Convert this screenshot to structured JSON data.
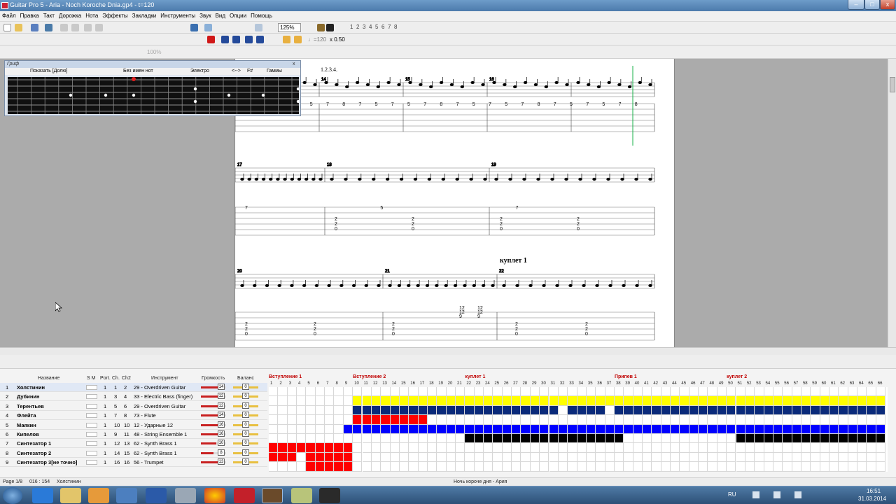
{
  "window": {
    "title": "Guitar Pro 5 - Aria - Noch Koroche Dnia.gp4 - t=120",
    "btn_min": "‒",
    "btn_max": "□",
    "btn_close": "x"
  },
  "menu": [
    "Файл",
    "Правка",
    "Такт",
    "Дорожка",
    "Нота",
    "Эффекты",
    "Закладки",
    "Инструменты",
    "Звук",
    "Вид",
    "Опции",
    "Помощь"
  ],
  "toolbar1": {
    "zoom": "125%",
    "page_numbers": [
      "1",
      "2",
      "3",
      "4",
      "5",
      "6",
      "7",
      "8"
    ]
  },
  "toolbar2": {
    "tempo_label": "♩=120",
    "speed": "x 0.50"
  },
  "toolbar3": {
    "velocity": "100%"
  },
  "fretboard_panel": {
    "title": "Гриф",
    "view": "Показать [Долю]",
    "scale_name": "Без имен нот",
    "tuning": "Электро",
    "key": "F#",
    "scales": "Гаммы",
    "nav": "<-->",
    "close": "x"
  },
  "score": {
    "repeat_ending": "1.2.3.4.",
    "section_label": "куплет 1",
    "systems": [
      {
        "bars": [
          "17",
          "14",
          "15",
          "16"
        ],
        "tab_line1": [
          "8",
          "7",
          "5",
          "7",
          "5",
          "7",
          "8",
          "7",
          "5",
          "7",
          "5",
          "7",
          "8",
          "7",
          "5",
          "7",
          "5",
          "7",
          "8",
          "7",
          "5",
          "7",
          "5",
          "7",
          "8"
        ]
      },
      {
        "bars": [
          "17",
          "18",
          "19"
        ],
        "tab_line1": [
          "7",
          "5",
          "7"
        ],
        "tab_chord": [
          "2",
          "2",
          "0"
        ]
      },
      {
        "bars": [
          "20",
          "21",
          "22"
        ],
        "tab_chord": [
          "2",
          "2",
          "0"
        ],
        "tab_high": [
          "12",
          "12",
          "9",
          "12",
          "12",
          "9"
        ]
      }
    ]
  },
  "tracks_panel": {
    "headers": {
      "name": "Название",
      "sm": "S M",
      "port": "Port.",
      "ch": "Ch.",
      "ch2": "Ch2",
      "instrument": "Инструмент",
      "volume": "Громкость",
      "balance": "Баланс"
    },
    "tracks": [
      {
        "num": "1",
        "name": "Холстинин",
        "port": "1",
        "ch": "1",
        "ch2": "2",
        "instrument": "29 - Overdriven Guitar",
        "volume_value": "14",
        "balance_value": "0",
        "volume_level": 0.8
      },
      {
        "num": "2",
        "name": "Дубинин",
        "port": "1",
        "ch": "3",
        "ch2": "4",
        "instrument": "33 - Electric Bass (finger)",
        "volume_value": "12",
        "balance_value": "0",
        "volume_level": 0.7
      },
      {
        "num": "3",
        "name": "Терентьев",
        "port": "1",
        "ch": "5",
        "ch2": "6",
        "instrument": "29 - Overdriven Guitar",
        "volume_value": "12",
        "balance_value": "0",
        "volume_level": 0.7
      },
      {
        "num": "4",
        "name": "Флейта",
        "port": "1",
        "ch": "7",
        "ch2": "8",
        "instrument": "73 - Flute",
        "volume_value": "14",
        "balance_value": "0",
        "volume_level": 0.8
      },
      {
        "num": "5",
        "name": "Маякин",
        "port": "1",
        "ch": "10",
        "ch2": "10",
        "instrument": "12 - Ударные 12",
        "volume_value": "16",
        "balance_value": "0",
        "volume_level": 0.9
      },
      {
        "num": "6",
        "name": "Кипелов",
        "port": "1",
        "ch": "9",
        "ch2": "11",
        "instrument": "48 - String Ensemble 1",
        "volume_value": "16",
        "balance_value": "0",
        "volume_level": 0.9
      },
      {
        "num": "7",
        "name": "Синтезатор 1",
        "port": "1",
        "ch": "12",
        "ch2": "13",
        "instrument": "62 - Synth Brass 1",
        "volume_value": "10",
        "balance_value": "0",
        "volume_level": 0.6
      },
      {
        "num": "8",
        "name": "Синтезатор 2",
        "port": "1",
        "ch": "14",
        "ch2": "15",
        "instrument": "62 - Synth Brass 1",
        "volume_value": "8",
        "balance_value": "0",
        "volume_level": 0.5
      },
      {
        "num": "9",
        "name": "Синтезатор 3[не точно]",
        "port": "1",
        "ch": "16",
        "ch2": "16",
        "instrument": "56 - Trumpet",
        "volume_value": "13",
        "balance_value": "0",
        "volume_level": 0.75
      }
    ],
    "markers": [
      {
        "label": "Вступление 1",
        "bar": 1
      },
      {
        "label": "Вступление 2",
        "bar": 10
      },
      {
        "label": "куплет 1",
        "bar": 22
      },
      {
        "label": "Припев 1",
        "bar": 38
      },
      {
        "label": "куплет 2",
        "bar": 50
      }
    ],
    "bar_numbers": [
      "1",
      "2",
      "3",
      "4",
      "5",
      "6",
      "7",
      "8",
      "9",
      "10",
      "11",
      "12",
      "13",
      "14",
      "15",
      "16",
      "17",
      "18",
      "19",
      "20",
      "21",
      "22",
      "23",
      "24",
      "25",
      "26",
      "27",
      "28",
      "29",
      "30",
      "31",
      "32",
      "33",
      "34",
      "35",
      "36",
      "37",
      "38",
      "39",
      "40",
      "41",
      "42",
      "43",
      "44",
      "45",
      "46",
      "47",
      "48",
      "49",
      "50",
      "51",
      "52",
      "53",
      "54",
      "55",
      "56",
      "57",
      "58",
      "59",
      "60",
      "61",
      "62",
      "63",
      "64",
      "65",
      "66"
    ],
    "colors": {
      "track2": "#ffff00",
      "track3": "#0a2a7a",
      "track4": "#ff0000",
      "track5": "#0000ff",
      "track6": "#000000",
      "track7": "#ff0000",
      "track8": "#ff0000",
      "track9": "#ff0000"
    }
  },
  "status": {
    "page": "Page 1/8",
    "position": "016 : 154",
    "track": "Холстинин",
    "song": "Ночь короче дня - Ария"
  },
  "taskbar": {
    "lang": "RU",
    "time": "16:51",
    "date": "31.03.2014"
  }
}
